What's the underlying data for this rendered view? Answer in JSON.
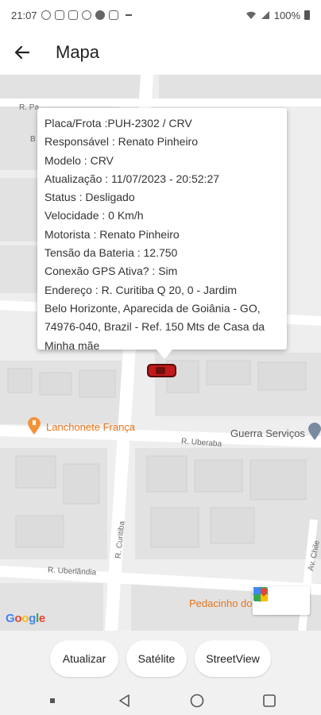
{
  "status_bar": {
    "time": "21:07",
    "battery": "100%"
  },
  "app_bar": {
    "title": "Mapa",
    "back_icon": "arrow-left-icon"
  },
  "map": {
    "streets": {
      "top_left": "R. Pa",
      "top_left_b": "B",
      "uberaba": "R. Uberaba",
      "curitiba": "R. Curitiba",
      "uberlandia": "R. Uberlândia",
      "right": "Av. Chile"
    },
    "pois": {
      "lanchonete": "Lanchonete França",
      "guerra": "Guerra Serviços",
      "pedacinho": "Pedacinho do"
    },
    "google_logo": [
      "G",
      "o",
      "o",
      "g",
      "l",
      "e"
    ],
    "controls": [
      "directions-icon",
      "google-maps-icon"
    ],
    "marker": "car-marker"
  },
  "info_window": {
    "lines": [
      "Placa/Frota :PUH-2302 / CRV",
      "Responsável : Renato Pinheiro",
      "Modelo : CRV",
      "Atualização : 11/07/2023 - 20:52:27",
      "Status : Desligado",
      "Velocidade : 0 Km/h",
      "Motorista : Renato Pinheiro",
      "Tensão da Bateria : 12.750",
      "Conexão GPS Ativa? : Sim",
      "Endereço : R. Curitiba Q 20, 0 - Jardim",
      "Belo Horizonte, Aparecida de Goiânia - GO,",
      "74976-040, Brazil - Ref. 150 Mts de Casa da",
      "Minha mãe"
    ]
  },
  "buttons": {
    "atualizar": "Atualizar",
    "satelite": "Satélite",
    "streetview": "StreetView"
  },
  "nav_bar": {
    "items": [
      "recents-icon",
      "back-triangle-icon",
      "home-circle-icon",
      "overview-square-icon"
    ]
  },
  "colors": {
    "poi_orange": "#e8761c",
    "marker_red": "#c21a1a"
  }
}
